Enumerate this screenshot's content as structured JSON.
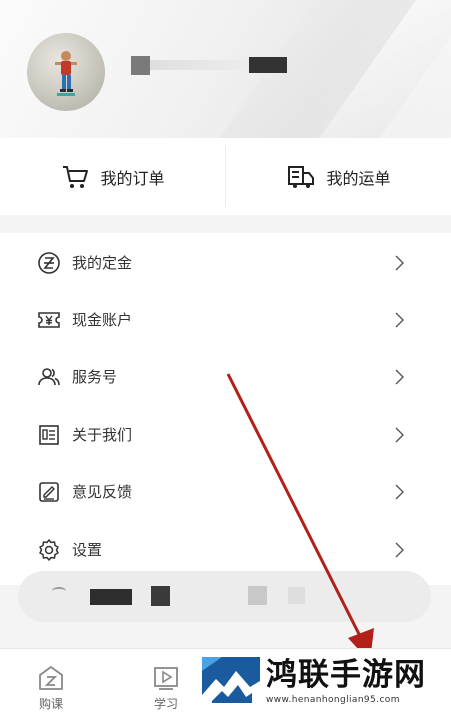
{
  "profile": {
    "avatar_alt": "avatar"
  },
  "orders": {
    "my_orders": "我的订单",
    "my_shipments": "我的运单"
  },
  "menu": {
    "items": [
      {
        "label": "我的定金",
        "icon": "deposit-coin-icon"
      },
      {
        "label": "现金账户",
        "icon": "cash-ticket-icon"
      },
      {
        "label": "服务号",
        "icon": "people-icon"
      },
      {
        "label": "关于我们",
        "icon": "info-card-icon"
      },
      {
        "label": "意见反馈",
        "icon": "edit-feedback-icon"
      },
      {
        "label": "设置",
        "icon": "gear-icon"
      }
    ]
  },
  "bottom_nav": {
    "items": [
      {
        "label": "购课",
        "icon": "course-shop-icon"
      },
      {
        "label": "学习",
        "icon": "play-learn-icon"
      }
    ]
  },
  "watermark": {
    "title": "鸿联手游网",
    "url": "www.henanhonglian95.com"
  },
  "colors": {
    "accent_red": "#b3201a",
    "text": "#333333"
  }
}
